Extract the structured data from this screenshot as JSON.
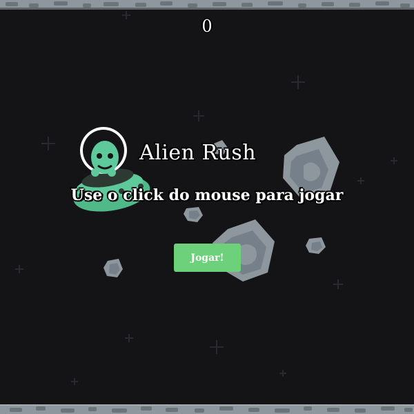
{
  "game": {
    "score": "0",
    "title": "Alien Rush",
    "instructions": "Use o click do mouse para jogar",
    "play_button_label": "Jogar!"
  },
  "colors": {
    "background": "#141316",
    "rock": "#8e979d",
    "rock_shadow": "#6b7479",
    "alien_green": "#5ec99b",
    "button_green": "#6dd07a",
    "text": "#ffffff"
  },
  "icons": [
    "alien-ufo-icon",
    "asteroid-icon",
    "star-icon"
  ]
}
